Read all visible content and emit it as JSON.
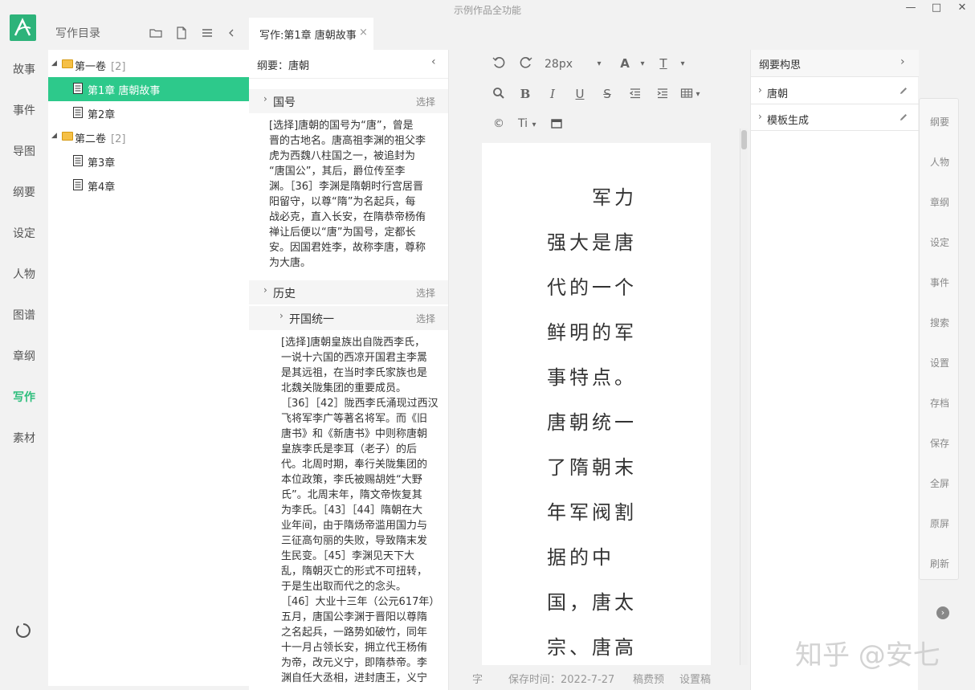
{
  "window": {
    "title": "示例作品全功能",
    "controls": {
      "minimize": "—",
      "maximize": "□",
      "close": "✕"
    }
  },
  "app_icon": {
    "name": "app-logo-icon",
    "color": "#2db37a"
  },
  "left_nav": {
    "items": [
      "故事",
      "事件",
      "导图",
      "纲要",
      "设定",
      "人物",
      "图谱",
      "章纲",
      "写作",
      "素材"
    ],
    "active": "写作",
    "active_color": "#2dbe7c"
  },
  "directory": {
    "title": "写作目录",
    "icons": [
      "folder-icon",
      "file-icon",
      "menu-icon",
      "collapse-icon"
    ],
    "tree": [
      {
        "type": "volume",
        "label": "第一卷",
        "count": "[2]"
      },
      {
        "type": "chapter",
        "label": "第1章 唐朝故事",
        "selected": true
      },
      {
        "type": "chapter",
        "label": "第2章"
      },
      {
        "type": "volume",
        "label": "第二卷",
        "count": "[2]"
      },
      {
        "type": "chapter",
        "label": "第3章"
      },
      {
        "type": "chapter",
        "label": "第4章"
      }
    ],
    "selected_color": "#2dc98b"
  },
  "tab": {
    "label": "写作:第1章 唐朝故事",
    "close": "×"
  },
  "outline": {
    "title": "纲要：唐朝",
    "sections": [
      {
        "name": "国号",
        "select": "选择",
        "text": [
          "[选择]唐朝的国号为“唐”，曾是",
          "晋的古地名。唐高祖李渊的祖父李",
          "虎为西魏八柱国之一，被追封为",
          "“唐国公”，其后，爵位传至李",
          "渊。［36］李渊是隋朝时行宫居晋",
          "阳留守，以尊“隋”为名起兵，每",
          "战必克，直入长安，在隋恭帝杨侑",
          "禅让后便以“唐”为国号，定都长",
          "安。因国君姓李，故称李唐，尊称",
          "为大唐。"
        ]
      },
      {
        "name": "历史",
        "select": "选择"
      },
      {
        "name": "开国统一",
        "select": "选择",
        "text": [
          "[选择]唐朝皇族出自陇西李氏，",
          "一说十六国的西凉开国君主李暠",
          "是其远祖，在当时李氏家族也是",
          "北魏关陇集团的重要成员。",
          "［36］［42］陇西李氏涌现过西汉",
          "飞将军李广等著名将军。而《旧",
          "唐书》和《新唐书》中则称唐朝",
          "皇族李氏是李耳（老子）的后",
          "代。北周时期，奉行关陇集团的",
          "本位政策，李氏被赐胡姓“大野",
          "氏”。北周末年，隋文帝恢复其",
          "为李氏。［43］［44］隋朝在大",
          "业年间，由于隋炀帝滥用国力与",
          "三征高句丽的失败，导致隋末发",
          "生民变。［45］李渊见天下大",
          "乱，隋朝灭亡的形式不可扭转，",
          "于是生出取而代之的念头。",
          "［46］大业十三年（公元617年）",
          "五月，唐国公李渊于晋阳以尊隋",
          "之名起兵，一路势如破竹，同年",
          "十一月占领长安，拥立代王杨侑",
          "为帝，改元义宁，即隋恭帝。李",
          "渊自任大丞相，进封唐王，义宁"
        ]
      }
    ]
  },
  "editor": {
    "font_size": "28px",
    "toolbar_labels": {
      "text_color": "A",
      "text_style": "T",
      "ti": "Ti",
      "copyright": "©"
    },
    "lines": [
      "军力",
      "强大是唐",
      "代的一个",
      "鲜明的军",
      "事特点。",
      "唐朝统一",
      "了隋朝末",
      "年军阀割",
      "据的中",
      "国，唐太",
      "宗、唐高"
    ],
    "status": {
      "chars": "字",
      "save_time": "保存时间：2022-7-27",
      "fee": "稿费预",
      "settings": "设置稿"
    }
  },
  "idea": {
    "title": "纲要构思",
    "items": [
      "唐朝",
      "模板生成"
    ]
  },
  "right_nav": {
    "items": [
      "纲要",
      "人物",
      "章纲",
      "设定",
      "事件",
      "搜索",
      "设置",
      "存档",
      "保存",
      "全屏",
      "原屏",
      "刷新"
    ]
  },
  "watermark": "知乎 @安七"
}
